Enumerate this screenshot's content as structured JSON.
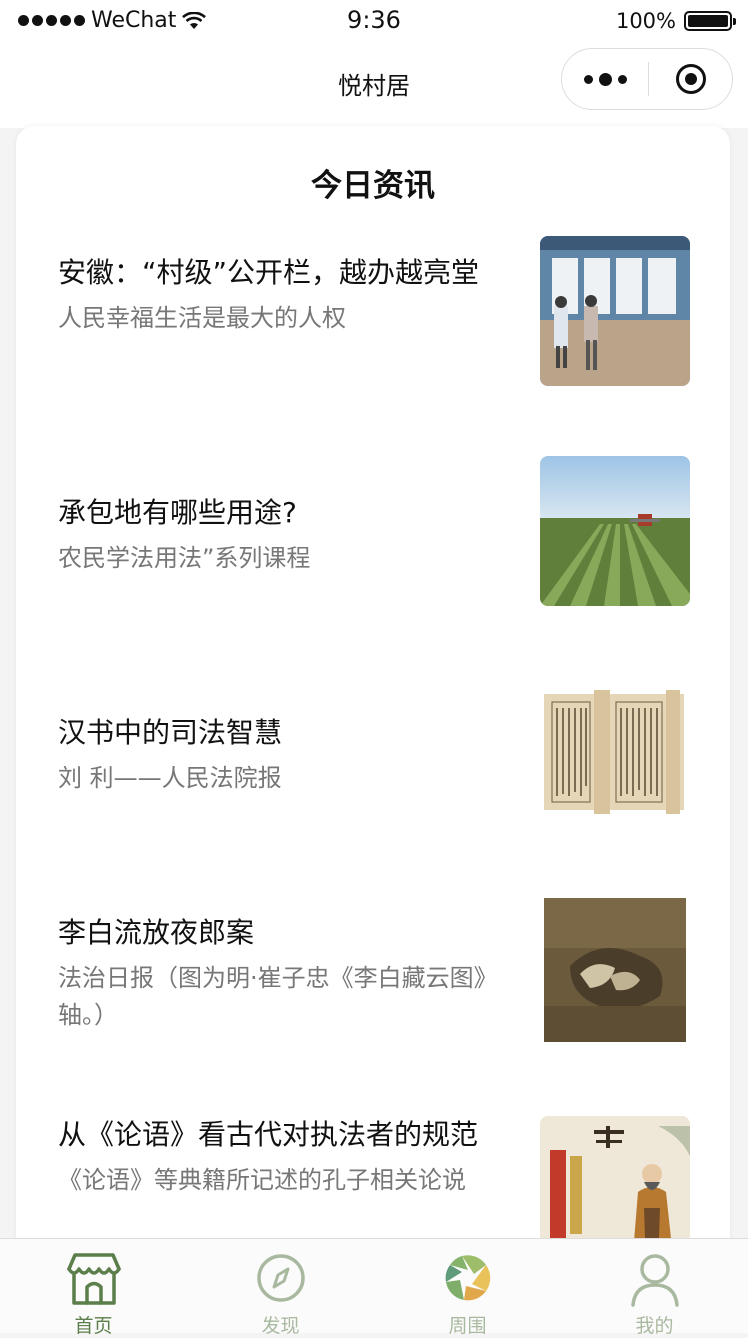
{
  "status_bar": {
    "carrier": "WeChat",
    "time": "9:36",
    "battery": "100%"
  },
  "nav": {
    "title": "悦村居"
  },
  "news": {
    "heading": "今日资讯",
    "items": [
      {
        "title": "安徽：“村级”公开栏，越办越亮堂",
        "subtitle": "人民幸福生活是最大的人权",
        "image": "notice-board-photo"
      },
      {
        "title": "承包地有哪些用途?",
        "subtitle": "农民学法用法”系列课程",
        "image": "farmland-photo"
      },
      {
        "title": "汉书中的司法智慧",
        "subtitle": "刘 利——人民法院报",
        "image": "ancient-book-photo"
      },
      {
        "title": "李白流放夜郎案",
        "subtitle": "法治日报（图为明·崔子忠《李白藏云图》轴。）",
        "image": "painting-photo"
      },
      {
        "title": "从《论语》看古代对执法者的规范",
        "subtitle": "《论语》等典籍所记述的孔子相关论说",
        "image": "confucius-illustration"
      }
    ]
  },
  "tabs": [
    {
      "label": "首页",
      "icon": "storefront-icon",
      "active": true
    },
    {
      "label": "发现",
      "icon": "compass-icon",
      "active": false
    },
    {
      "label": "周围",
      "icon": "aperture-icon",
      "active": false
    },
    {
      "label": "我的",
      "icon": "person-icon",
      "active": false
    }
  ],
  "colors": {
    "active_tab": "#5b7e4a",
    "inactive_tab": "#a9b9a0",
    "subtitle": "#777777"
  }
}
